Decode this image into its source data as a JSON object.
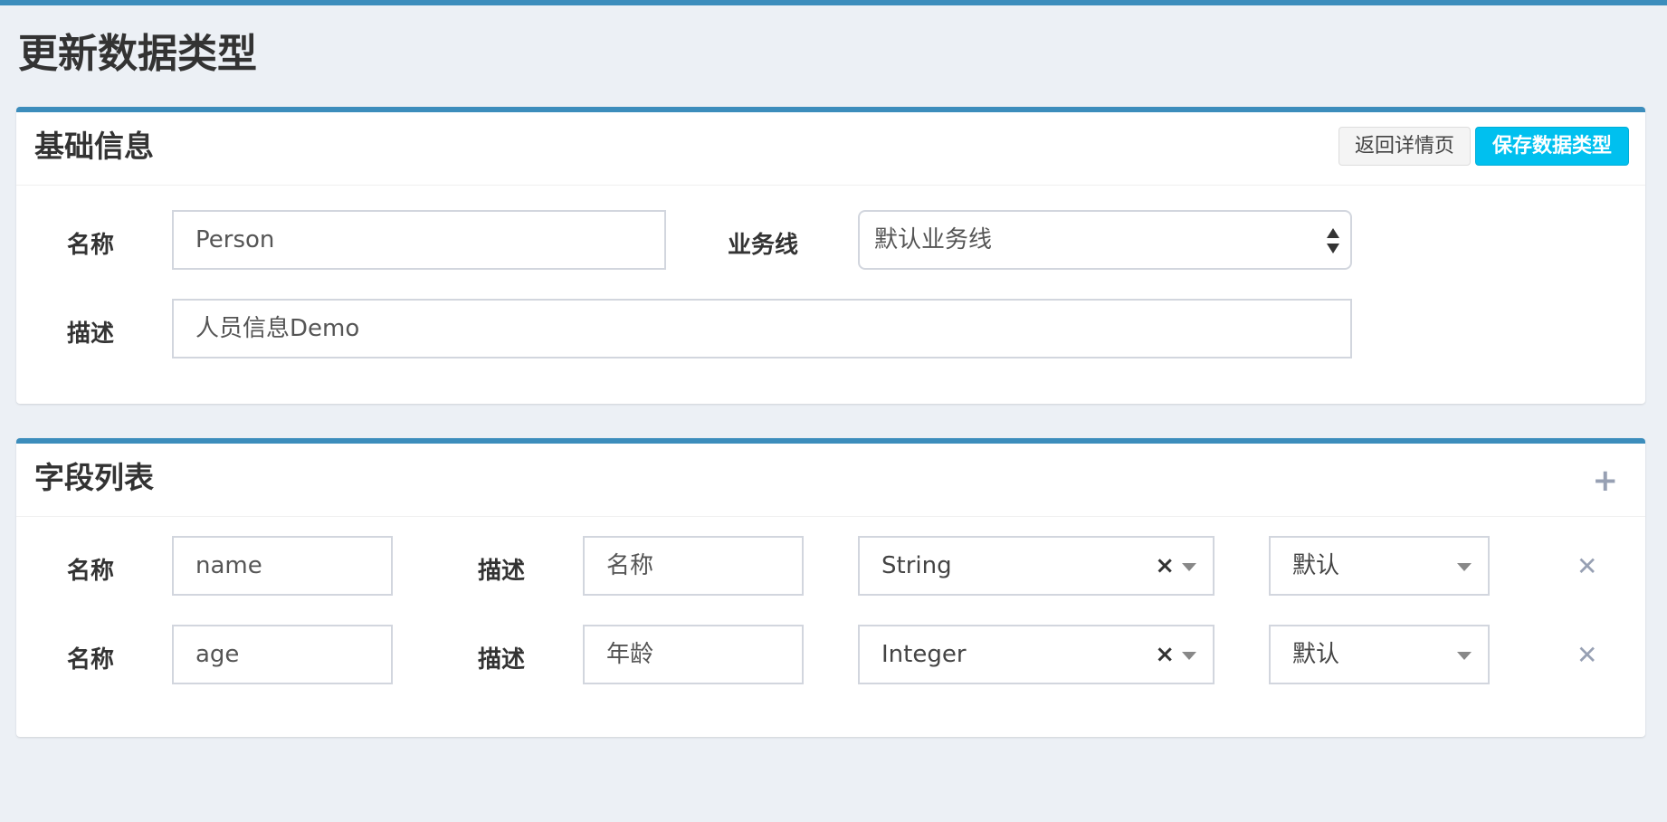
{
  "page": {
    "title": "更新数据类型"
  },
  "basic": {
    "title": "基础信息",
    "back_label": "返回详情页",
    "save_label": "保存数据类型",
    "name_label": "名称",
    "name_value": "Person",
    "line_label": "业务线",
    "line_value": "默认业务线",
    "desc_label": "描述",
    "desc_value": "人员信息Demo"
  },
  "fields": {
    "title": "字段列表",
    "add_icon": "plus-icon",
    "rows": [
      {
        "name_label": "名称",
        "name_value": "name",
        "desc_label": "描述",
        "desc_value": "名称",
        "type": "String",
        "default": "默认"
      },
      {
        "name_label": "名称",
        "name_value": "age",
        "desc_label": "描述",
        "desc_value": "年龄",
        "type": "Integer",
        "default": "默认"
      }
    ]
  },
  "colors": {
    "accent": "#3c8dbc",
    "info": "#00c0ef",
    "background": "#ecf0f5"
  }
}
